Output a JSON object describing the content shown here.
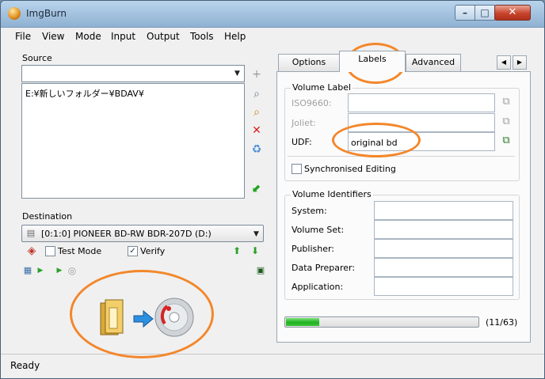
{
  "window": {
    "title": "ImgBurn"
  },
  "menu": [
    "File",
    "View",
    "Mode",
    "Input",
    "Output",
    "Tools",
    "Help"
  ],
  "source": {
    "label": "Source",
    "path": "E:¥新しいフォルダー¥BDAV¥"
  },
  "destination": {
    "label": "Destination",
    "drive": "[0:1:0] PIONEER BD-RW   BDR-207D (D:)",
    "test_mode": {
      "label": "Test Mode",
      "checked": false
    },
    "verify": {
      "label": "Verify",
      "checked": true
    }
  },
  "tabs": [
    "Options",
    "Labels",
    "Advanced"
  ],
  "active_tab": "Labels",
  "volume_label": {
    "title": "Volume Label",
    "iso9660": {
      "label": "ISO9660:",
      "value": ""
    },
    "joliet": {
      "label": "Joliet:",
      "value": ""
    },
    "udf": {
      "label": "UDF:",
      "value": "original bd"
    },
    "sync": {
      "label": "Synchronised Editing",
      "checked": false
    }
  },
  "volume_identifiers": {
    "title": "Volume Identifiers",
    "fields": [
      {
        "label": "System:",
        "value": ""
      },
      {
        "label": "Volume Set:",
        "value": ""
      },
      {
        "label": "Publisher:",
        "value": ""
      },
      {
        "label": "Data Preparer:",
        "value": ""
      },
      {
        "label": "Application:",
        "value": ""
      }
    ]
  },
  "progress": {
    "fraction": 0.175,
    "label": "(11/63)"
  },
  "status": "Ready",
  "colors": {
    "annotation": "#f3872b",
    "progress": "#1fb21f",
    "titlebar": "#b9d4ec"
  }
}
